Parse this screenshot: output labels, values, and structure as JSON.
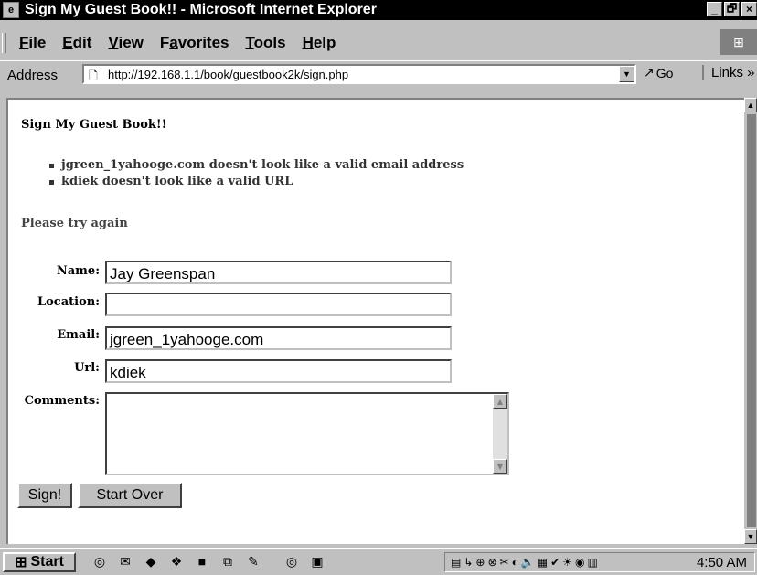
{
  "window": {
    "title": "Sign My Guest Book!! - Microsoft Internet Explorer",
    "controls": [
      "_",
      "🗗",
      "×"
    ]
  },
  "menu": {
    "items": [
      "File",
      "Edit",
      "View",
      "Favorites",
      "Tools",
      "Help"
    ],
    "mnemonics": [
      "F",
      "E",
      "V",
      "a",
      "T",
      "H"
    ]
  },
  "address_bar": {
    "label": "Address",
    "url": "http://192.168.1.1/book/guestbook2k/sign.php",
    "go_label": "Go",
    "links_label": "Links »"
  },
  "page": {
    "title": "Sign My Guest Book!!",
    "errors": [
      "jgreen_1yahooge.com doesn't look like a valid email address",
      "kdiek doesn't look like a valid URL"
    ],
    "retry_message": "Please try again"
  },
  "form": {
    "name_label": "Name:",
    "name_value": "Jay Greenspan",
    "location_label": "Location:",
    "location_value": "",
    "email_label": "Email:",
    "email_value": "jgreen_1yahooge.com",
    "url_label": "Url:",
    "url_value": "kdiek",
    "comments_label": "Comments:",
    "comments_value": "",
    "submit_label": "Sign!",
    "reset_label": "Start Over"
  },
  "taskbar": {
    "start_label": "Start",
    "clock": "4:50 AM"
  },
  "icons": {
    "browser": "ie-page-icon",
    "go": "go-arrow-icon"
  }
}
